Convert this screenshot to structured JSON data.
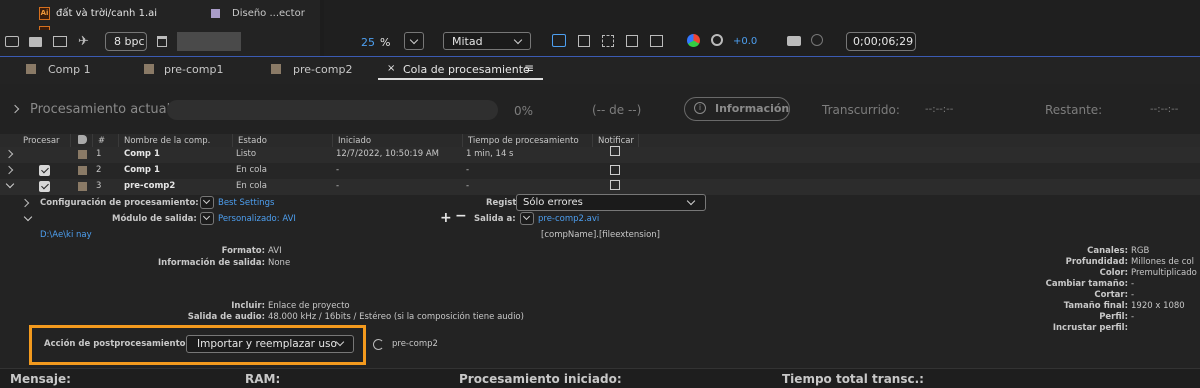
{
  "project_panel": {
    "file_name": "đất và trời/canh 1.ai",
    "file_type": "Diseño ...ector",
    "bpc_label": "8 bpc"
  },
  "viewer_toolbar": {
    "zoom_value": "25",
    "zoom_unit": "%",
    "resolution": "Mitad",
    "exposure_value": "+0.0",
    "timecode": "0;00;06;29"
  },
  "tabs": [
    {
      "label": "Comp 1"
    },
    {
      "label": "pre-comp1"
    },
    {
      "label": "pre-comp2"
    },
    {
      "label": "Cola de procesamiento",
      "active": true
    }
  ],
  "progress": {
    "title": "Procesamiento actual",
    "percent": "0%",
    "of_label": "(-- de --)",
    "info_button": "Información",
    "elapsed_label": "Transcurrido:",
    "elapsed_value": "--:--:--",
    "remaining_label": "Restante:",
    "remaining_value": "--:--:--"
  },
  "columns": {
    "render": "Procesar",
    "num": "#",
    "comp_name": "Nombre de la comp.",
    "status": "Estado",
    "started": "Iniciado",
    "render_time": "Tiempo de procesamiento",
    "notify": "Notificar"
  },
  "queue_rows": [
    {
      "num": "1",
      "comp": "Comp 1",
      "status": "Listo",
      "started": "12/7/2022, 10:50:19 AM",
      "time": "1 min, 14 s",
      "checked": false,
      "color": "#8a7a66"
    },
    {
      "num": "2",
      "comp": "Comp 1",
      "status": "En cola",
      "started": "-",
      "time": "-",
      "checked": true,
      "color": "#8a7a66"
    },
    {
      "num": "3",
      "comp": "pre-comp2",
      "status": "En cola",
      "started": "-",
      "time": "-",
      "checked": true,
      "color": "#8a7a66"
    }
  ],
  "render_settings": {
    "label": "Configuración de procesamiento:",
    "value": "Best Settings",
    "log_label": "Registro:",
    "log_value": "Sólo errores"
  },
  "output_module": {
    "label": "Módulo de salida:",
    "value": "Personalizado: AVI",
    "output_to_label": "Salida a:",
    "output_file": "pre-comp2.avi",
    "template": "[compName].[fileextension]",
    "path": "D:\\Ae\\ki nay"
  },
  "details_left": [
    {
      "label": "Formato:",
      "value": "AVI"
    },
    {
      "label": "Información de salida:",
      "value": "None"
    }
  ],
  "details_left_bottom": [
    {
      "label": "Incluir:",
      "value": "Enlace de proyecto"
    },
    {
      "label": "Salida de audio:",
      "value": "48.000 kHz / 16bits / Estéreo (si la composición tiene audio)"
    }
  ],
  "details_right": [
    {
      "label": "Canales:",
      "value": "RGB"
    },
    {
      "label": "Profundidad:",
      "value": "Millones de col"
    },
    {
      "label": "Color:",
      "value": "Premultiplicado"
    },
    {
      "label": "Cambiar tamaño:",
      "value": "-"
    },
    {
      "label": "Cortar:",
      "value": "-"
    },
    {
      "label": "Tamaño final:",
      "value": "1920 x 1080"
    },
    {
      "label": "Perfil:",
      "value": "-"
    },
    {
      "label": "Incrustar perfil:",
      "value": ""
    }
  ],
  "post_render": {
    "label": "Acción de postprocesamiento:",
    "value": "Importar y reemplazar uso",
    "target": "pre-comp2",
    "highlight_color": "#f39a1e"
  },
  "status_bar": {
    "message": "Mensaje:",
    "ram": "RAM:",
    "render_started": "Procesamiento iniciado:",
    "total_time": "Tiempo total transc.:"
  }
}
